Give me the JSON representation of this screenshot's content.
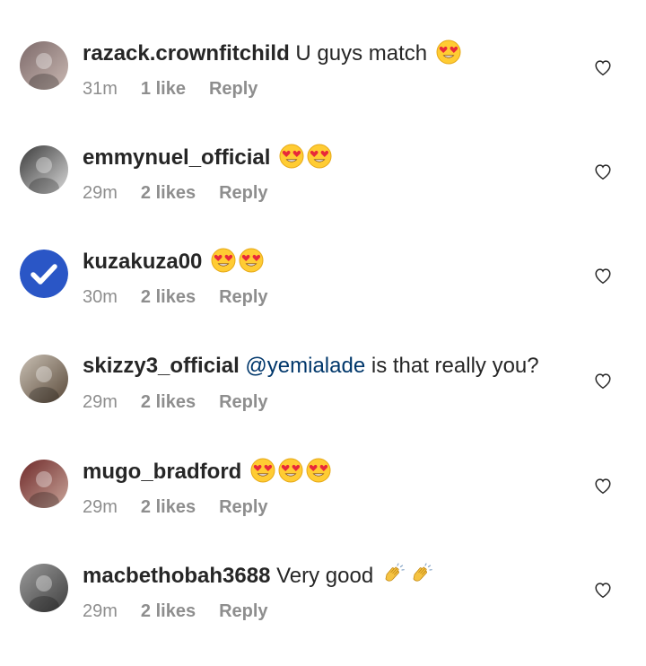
{
  "comments": [
    {
      "username": "razack.crownfitchild",
      "text": "U guys match",
      "mention": "",
      "trailing": "",
      "emojis": [
        "heart-eyes-emoji"
      ],
      "time": "31m",
      "likes": "1 like",
      "reply": "Reply",
      "avatar": "photo-avatar"
    },
    {
      "username": "emmynuel_official",
      "text": "",
      "mention": "",
      "trailing": "",
      "emojis": [
        "heart-eyes-emoji",
        "heart-eyes-emoji"
      ],
      "time": "29m",
      "likes": "2 likes",
      "reply": "Reply",
      "avatar": "photo-avatar"
    },
    {
      "username": "kuzakuza00",
      "text": "",
      "mention": "",
      "trailing": "",
      "emojis": [
        "heart-eyes-emoji",
        "heart-eyes-emoji"
      ],
      "time": "30m",
      "likes": "2 likes",
      "reply": "Reply",
      "avatar": "checkmark-avatar"
    },
    {
      "username": "skizzy3_official",
      "text": "",
      "mention": "@yemialade",
      "trailing": " is that really you?",
      "emojis": [],
      "time": "29m",
      "likes": "2 likes",
      "reply": "Reply",
      "avatar": "photo-avatar"
    },
    {
      "username": "mugo_bradford",
      "text": "",
      "mention": "",
      "trailing": "",
      "emojis": [
        "heart-eyes-emoji",
        "heart-eyes-emoji",
        "heart-eyes-emoji"
      ],
      "time": "29m",
      "likes": "2 likes",
      "reply": "Reply",
      "avatar": "photo-avatar"
    },
    {
      "username": "macbethobah3688",
      "text": "Very good",
      "mention": "",
      "trailing": "",
      "emojis": [
        "clapping-hands-emoji",
        "clapping-hands-emoji"
      ],
      "time": "29m",
      "likes": "2 likes",
      "reply": "Reply",
      "avatar": "photo-avatar"
    }
  ],
  "colors": {
    "text": "#262626",
    "meta": "#8e8e8e",
    "mention": "#00376b",
    "verified_blue": "#2a56c6"
  }
}
